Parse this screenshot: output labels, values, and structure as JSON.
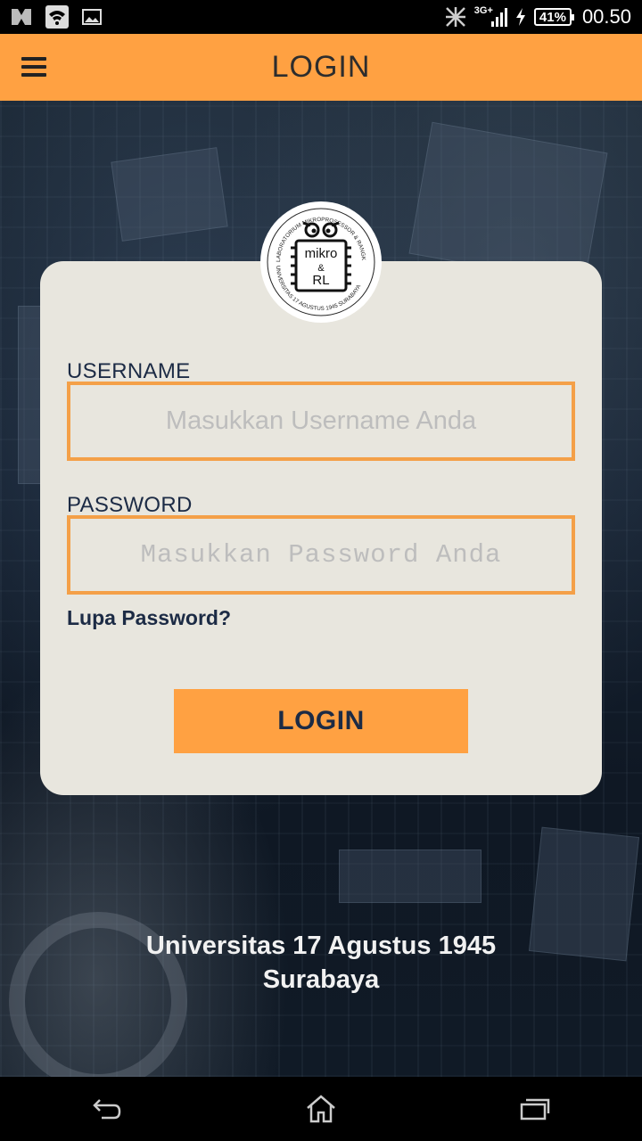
{
  "status_bar": {
    "network_label": "3G+",
    "battery": "41%",
    "time": "00.50"
  },
  "app_bar": {
    "title": "LOGIN",
    "menu_icon": "hamburger-menu-icon"
  },
  "logo": {
    "text_line1": "mikro",
    "text_line2": "&",
    "text_line3": "RL",
    "ring_text": "LABORATORIUM MIKROPROSESSOR & RANGKAIAN LOGIKA UNIVERSITAS 17 AGUSTUS 1945 SURABAYA"
  },
  "form": {
    "username_label": "USERNAME",
    "username_placeholder": "Masukkan Username Anda",
    "username_value": "",
    "password_label": "PASSWORD",
    "password_placeholder": "Masukkan Password Anda",
    "password_value": "",
    "forgot_link": "Lupa Password?",
    "login_button": "LOGIN"
  },
  "footer": {
    "line1": "Universitas 17 Agustus 1945",
    "line2": "Surabaya"
  },
  "nav_bar": {
    "back_icon": "back-icon",
    "home_icon": "home-icon",
    "recents_icon": "recents-icon"
  },
  "colors": {
    "accent": "#ffa142",
    "field_border": "#f4a048",
    "card": "#e8e6de",
    "text_dark": "#1c2b45"
  }
}
